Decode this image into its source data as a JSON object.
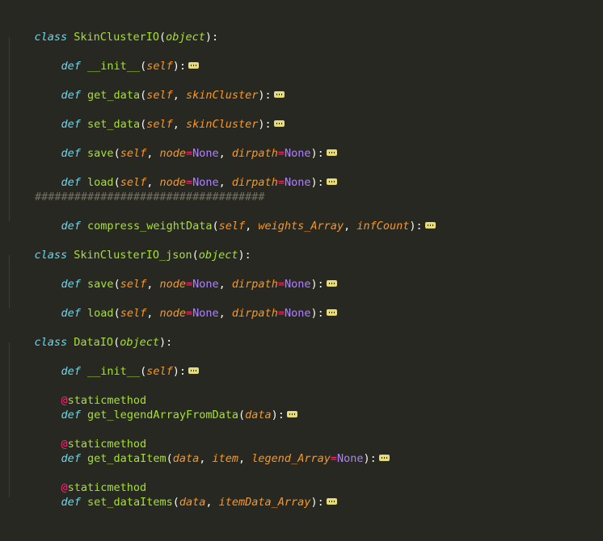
{
  "theme": {
    "background": "#272822",
    "keyword": "#66d9ef",
    "function": "#a6e22e",
    "parameter": "#fd971f",
    "operator": "#f92672",
    "constant": "#ae81ff",
    "comment": "#75715e",
    "fold_marker": "#e6db74"
  },
  "fold_icon": "folded-code-ellipsis-icon",
  "kw": {
    "class": "class",
    "def": "def",
    "none": "None"
  },
  "classes": [
    {
      "name": "SkinClusterIO",
      "base": "object",
      "methods": [
        {
          "name": "__init__",
          "params": "self"
        },
        {
          "name": "get_data",
          "params": "self, skinCluster"
        },
        {
          "name": "set_data",
          "params": "self, skinCluster"
        },
        {
          "name": "save",
          "params": "self, node=None, dirpath=None"
        },
        {
          "name": "load",
          "params": "self, node=None, dirpath=None"
        },
        {
          "name": "compress_weightData",
          "params": "self, weights_Array, infCount"
        }
      ],
      "comment": "###################################"
    },
    {
      "name": "SkinClusterIO_json",
      "base": "object",
      "methods": [
        {
          "name": "save",
          "params": "self, node=None, dirpath=None"
        },
        {
          "name": "load",
          "params": "self, node=None, dirpath=None"
        }
      ]
    },
    {
      "name": "DataIO",
      "base": "object",
      "methods": [
        {
          "name": "__init__",
          "params": "self"
        },
        {
          "name": "get_legendArrayFromData",
          "params": "data",
          "decorator": "staticmethod"
        },
        {
          "name": "get_dataItem",
          "params": "data, item, legend_Array=None",
          "decorator": "staticmethod"
        },
        {
          "name": "set_dataItems",
          "params": "data, itemData_Array",
          "decorator": "staticmethod"
        }
      ]
    }
  ]
}
